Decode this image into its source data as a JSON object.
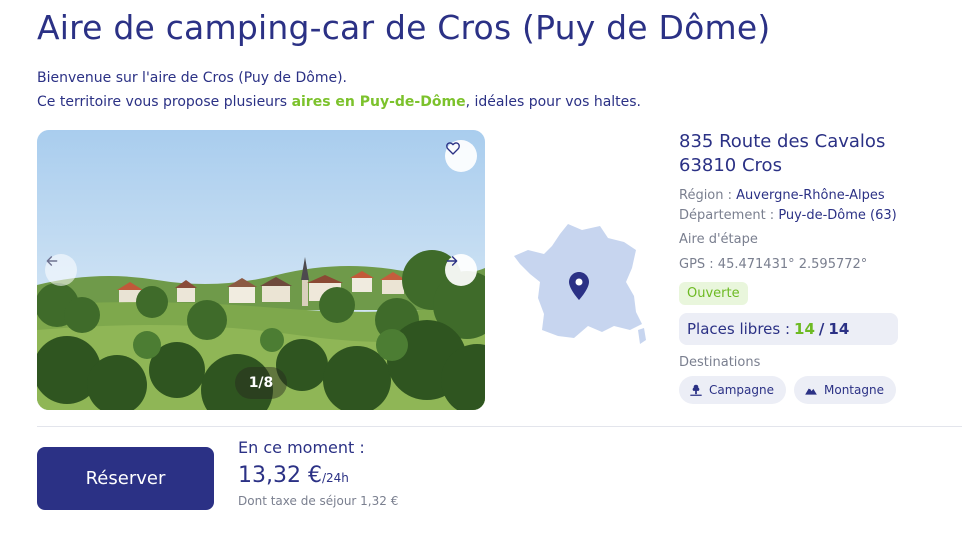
{
  "page": {
    "title": "Aire de camping-car de Cros (Puy de Dôme)",
    "intro_line1": "Bienvenue sur l'aire de Cros (Puy de Dôme).",
    "intro_line2_before": "Ce territoire vous propose plusieurs ",
    "intro_link": "aires en Puy-de-Dôme",
    "intro_line2_after": ", idéales pour vos haltes."
  },
  "gallery": {
    "counter": "1/8",
    "icons": {
      "favorite": "heart-icon",
      "prev": "arrow-left-icon",
      "next": "arrow-right-icon"
    }
  },
  "map": {
    "icons": {
      "pin": "map-pin-icon"
    },
    "colors": {
      "land": "#c7d5ef",
      "pin": "#2b3185"
    }
  },
  "info": {
    "address_line1": "835 Route des Cavalos",
    "address_line2": "63810 Cros",
    "region_label": "Région : ",
    "region_value": "Auvergne-Rhône-Alpes",
    "department_label": "Département : ",
    "department_value": "Puy-de-Dôme (63)",
    "stopover": "Aire d'étape",
    "gps": "GPS : 45.471431° 2.595772°",
    "status": "Ouverte",
    "places_label": "Places libres :",
    "places_free": "14",
    "places_sep": "/",
    "places_total": "14",
    "destinations_title": "Destinations",
    "destinations": [
      {
        "label": "Campagne",
        "icon": "countryside-icon"
      },
      {
        "label": "Montagne",
        "icon": "mountain-icon"
      }
    ]
  },
  "booking": {
    "button": "Réserver",
    "now_label": "En ce moment :",
    "price": "13,32 €",
    "unit": "/24h",
    "tax": "Dont taxe de séjour 1,32 €"
  },
  "colors": {
    "primary": "#2b3185",
    "accent_green": "#7cc22c",
    "muted": "#7a7f8f",
    "chip_bg": "#eceef6"
  }
}
